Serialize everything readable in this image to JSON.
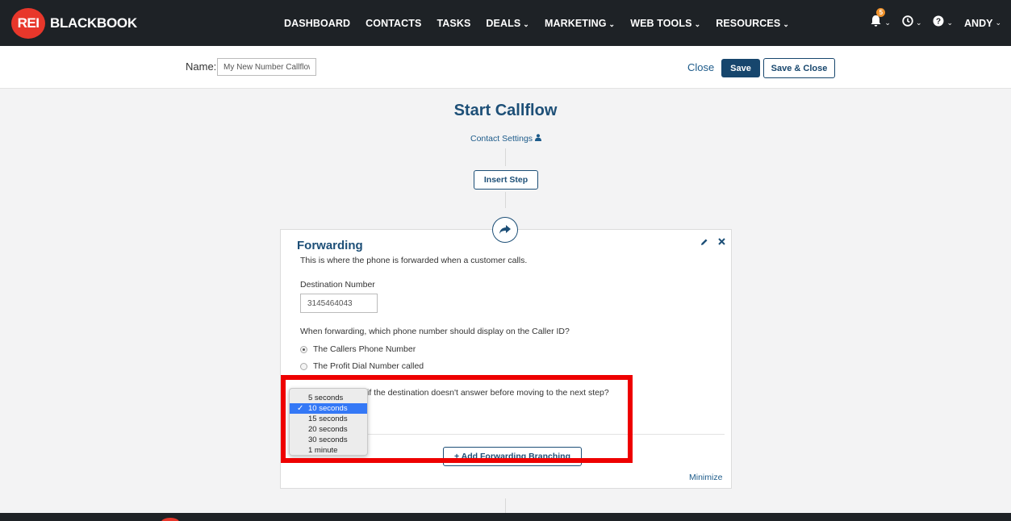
{
  "nav": {
    "logo_badge": "REI",
    "logo_text": "BLACKBOOK",
    "items": [
      {
        "label": "DASHBOARD",
        "caret": ""
      },
      {
        "label": "CONTACTS",
        "caret": ""
      },
      {
        "label": "TASKS",
        "caret": ""
      },
      {
        "label": "DEALS",
        "caret": "⌄"
      },
      {
        "label": "MARKETING",
        "caret": "⌄"
      },
      {
        "label": "WEB TOOLS",
        "caret": "⌄"
      },
      {
        "label": "RESOURCES",
        "caret": "⌄"
      }
    ],
    "notification_count": "5",
    "user": "ANDY",
    "caret": "⌄"
  },
  "header": {
    "name_label": "Name:",
    "name_value": "My New Number Callflow",
    "close_label": "Close",
    "save_label": "Save",
    "save_close_label": "Save & Close"
  },
  "flow": {
    "title": "Start Callflow",
    "contact_settings": "Contact Settings",
    "insert_step": "Insert Step"
  },
  "card": {
    "title": "Forwarding",
    "description": "This is where the phone is forwarded when a customer calls.",
    "dest_label": "Destination Number",
    "dest_value": "3145464043",
    "callerid_question": "When forwarding, which phone number should display on the Caller ID?",
    "radio_options": [
      {
        "label": "The Callers Phone Number",
        "checked": true
      },
      {
        "label": "The Profit Dial Number called",
        "checked": false
      }
    ],
    "wait_question": "if the destination doesn't answer before moving to the next step?",
    "add_branching": "+ Add Forwarding Branching",
    "minimize": "Minimize"
  },
  "dropdown": {
    "options": [
      "5 seconds",
      "10 seconds",
      "15 seconds",
      "20 seconds",
      "30 seconds",
      "1 minute"
    ],
    "selected": "10 seconds",
    "check_glyph": "✓"
  },
  "colors": {
    "nav_bg": "#1e2226",
    "brand_red": "#e8372b",
    "primary_blue": "#17466d",
    "highlight_red": "#ee0000",
    "selection_blue": "#3478f6"
  }
}
